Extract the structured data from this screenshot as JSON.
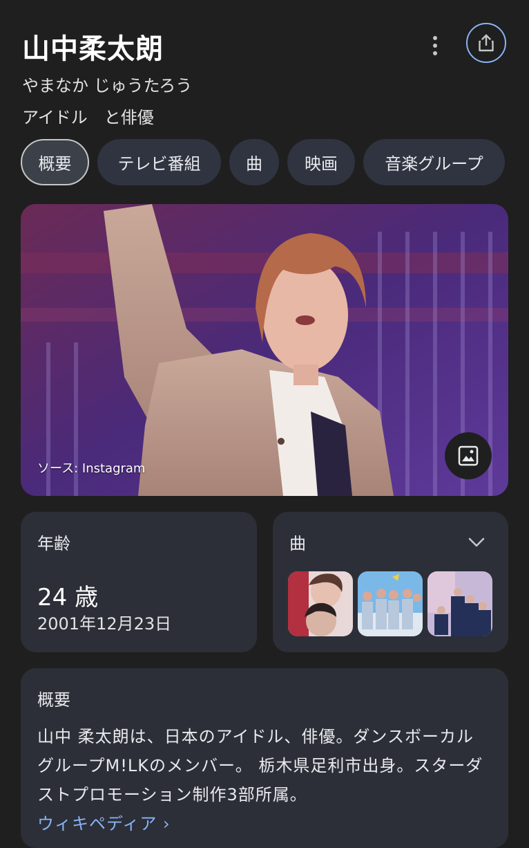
{
  "header": {
    "title": "山中柔太朗",
    "reading": "やまなか じゅうたろう",
    "description": "アイドル　と俳優",
    "more_icon": "more-vert-icon",
    "share_icon": "share-icon"
  },
  "chips": [
    {
      "label": "概要",
      "active": true
    },
    {
      "label": "テレビ番組",
      "active": false
    },
    {
      "label": "曲",
      "active": false
    },
    {
      "label": "映画",
      "active": false
    },
    {
      "label": "音楽グループ",
      "active": false
    }
  ],
  "hero": {
    "source": "ソース: Instagram",
    "image_button_icon": "image-icon"
  },
  "age_card": {
    "label": "年齢",
    "value": "24 歳",
    "birthdate": "2001年12月23日"
  },
  "songs_card": {
    "label": "曲",
    "expand_icon": "chevron-down-icon"
  },
  "overview": {
    "label": "概要",
    "text": "山中 柔太朗は、日本のアイドル、俳優。ダンスボーカルグループM!LKのメンバー。 栃木県足利市出身。スターダストプロモーション制作3部所属。",
    "link": "ウィキペディア ›"
  },
  "colors": {
    "background": "#1f1f1f",
    "card": "#2c2f38",
    "chip": "#303440",
    "link": "#8ab4f8"
  }
}
